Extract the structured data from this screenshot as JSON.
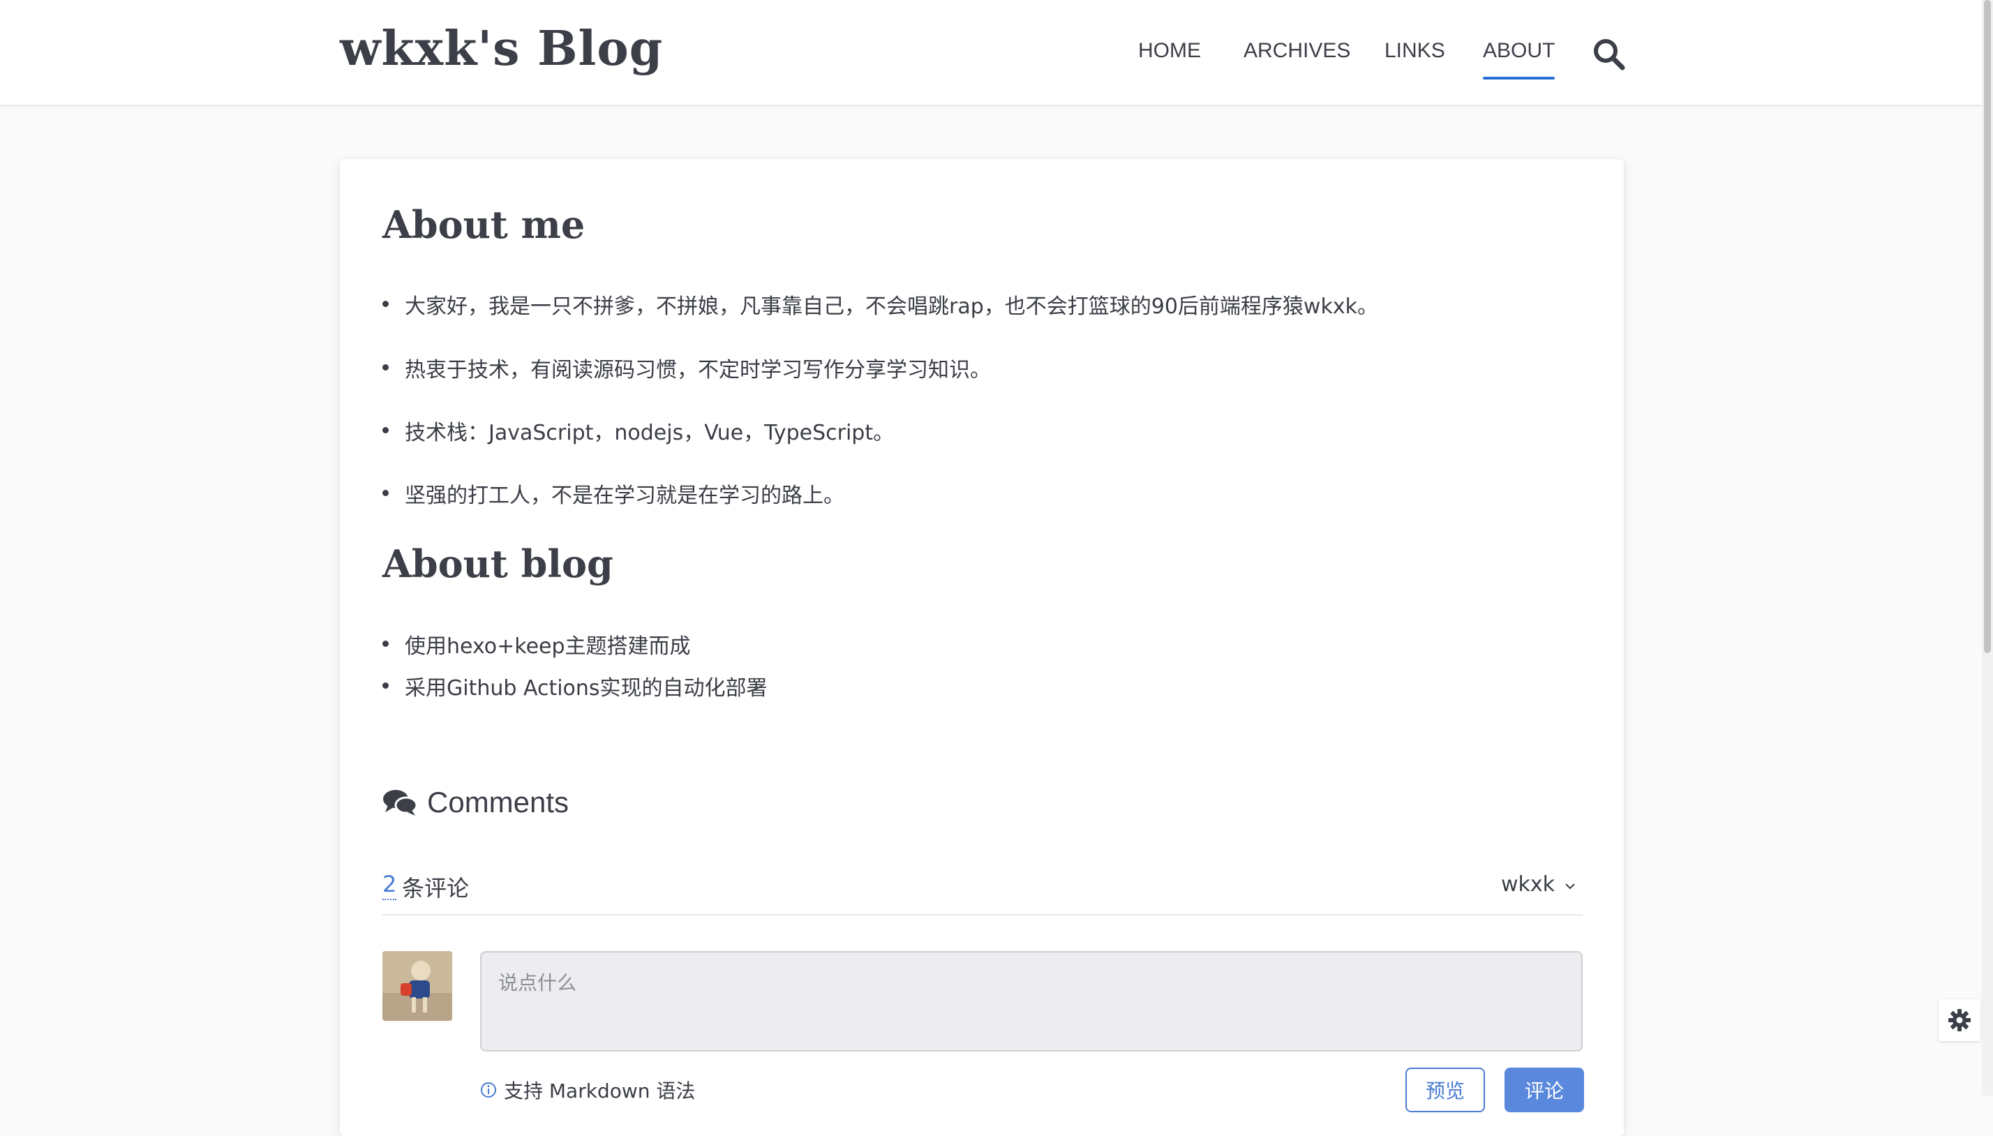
{
  "header": {
    "logo": "wkxk's Blog",
    "nav": [
      {
        "label": "HOME"
      },
      {
        "label": "ARCHIVES"
      },
      {
        "label": "LINKS"
      },
      {
        "label": "ABOUT",
        "active": true
      }
    ],
    "search_icon": "search-icon"
  },
  "about_me": {
    "heading": "About me",
    "items": [
      "大家好，我是一只不拼爹，不拼娘，凡事靠自己，不会唱跳rap，也不会打篮球的90后前端程序猿wkxk。",
      "热衷于技术，有阅读源码习惯，不定时学习写作分享学习知识。",
      "技术栈：JavaScript，nodejs，Vue，TypeScript。",
      "坚强的打工人，不是在学习就是在学习的路上。"
    ]
  },
  "about_blog": {
    "heading": "About blog",
    "items": [
      "使用hexo+keep主题搭建而成",
      "采用Github Actions实现的自动化部署"
    ]
  },
  "comments": {
    "title": "Comments",
    "count": "2",
    "count_label": "条评论",
    "user": "wkxk",
    "placeholder": "说点什么",
    "markdown_hint": "支持 Markdown 语法",
    "preview_label": "预览",
    "submit_label": "评论"
  },
  "colors": {
    "accent": "#2a6fd6",
    "link": "#4a7bd0",
    "submit_bg": "#5a88dc",
    "text": "#3a3d45"
  }
}
